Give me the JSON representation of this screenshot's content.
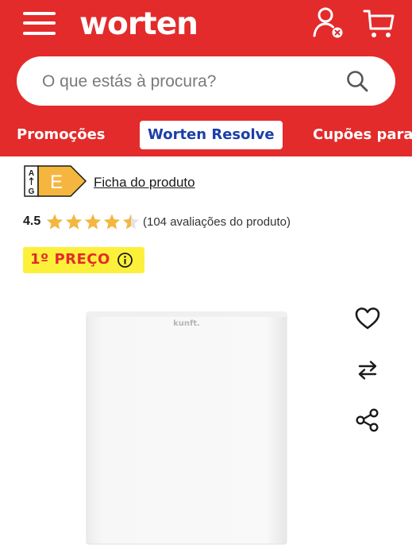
{
  "header": {
    "logo_text": "worten",
    "background_color": "#e32b2b",
    "menu_icon": "hamburger-menu-icon",
    "account_icon": "user-account-icon",
    "cart_icon": "shopping-cart-icon"
  },
  "search": {
    "placeholder": "O que estás à procura?",
    "value": "",
    "icon": "search-icon"
  },
  "nav": {
    "tabs": [
      {
        "label": "Promoções",
        "active": false
      },
      {
        "label": "Worten Resolve",
        "active": true
      },
      {
        "label": "Cupões para t",
        "active": false
      }
    ]
  },
  "product": {
    "energy_class": {
      "letter": "E",
      "scale_top": "A",
      "scale_bottom": "G",
      "color": "#f4b63f"
    },
    "product_sheet_link": "Ficha do produto",
    "rating": {
      "value": "4.5",
      "stars_out_of_5": 4.5,
      "review_count_text": "(104 avaliações do produto)",
      "star_color": "#f4b63f"
    },
    "price_badge": {
      "text": "1º PREÇO",
      "background_color": "#fdf03a",
      "text_color": "#e32b2b",
      "icon": "info-circle-icon"
    },
    "image": {
      "brand_text": "kunft."
    },
    "actions": {
      "favorite_icon": "heart-icon",
      "compare_icon": "compare-arrows-icon",
      "share_icon": "share-icon"
    }
  }
}
